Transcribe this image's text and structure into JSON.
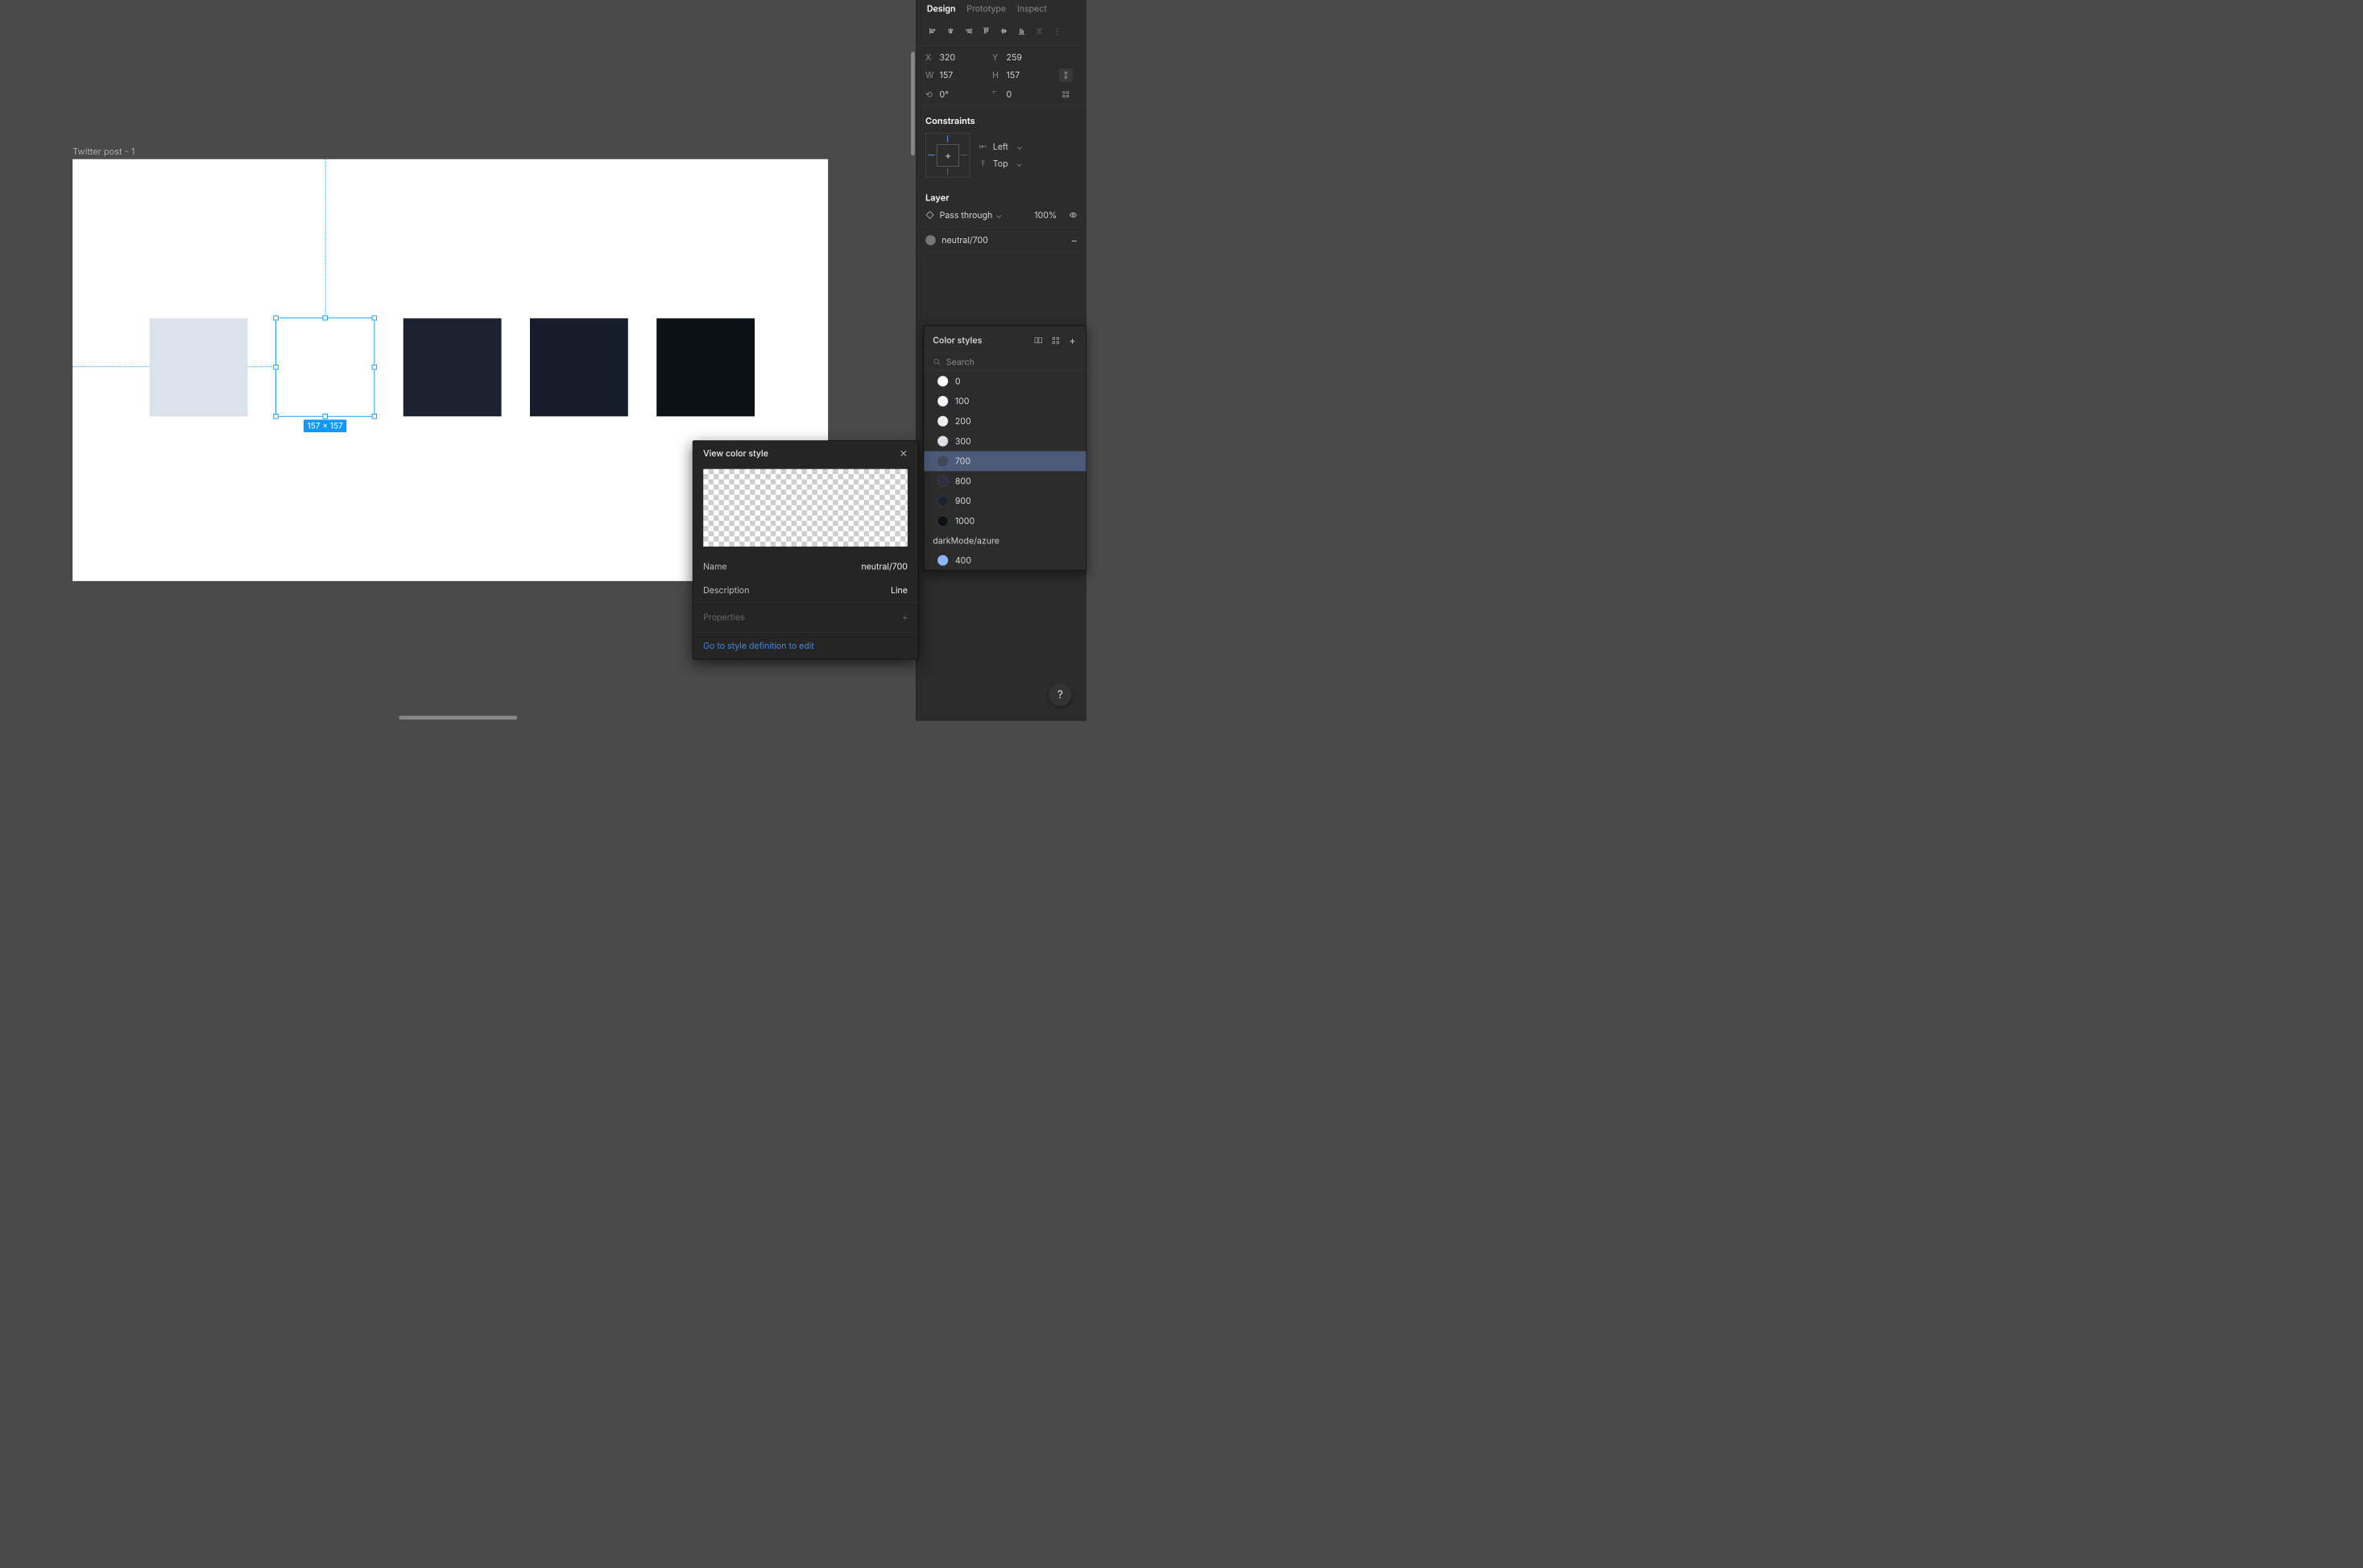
{
  "canvas": {
    "frameLabel": "Twitter post - 1",
    "selectionDims": "157 × 157"
  },
  "tabs": {
    "design": "Design",
    "prototype": "Prototype",
    "inspect": "Inspect"
  },
  "props": {
    "xLabel": "X",
    "x": "320",
    "yLabel": "Y",
    "y": "259",
    "wLabel": "W",
    "w": "157",
    "hLabel": "H",
    "h": "157",
    "rotLabel": "⤹",
    "rot": "0°",
    "radLabel": "⌐",
    "rad": "0"
  },
  "constraints": {
    "title": "Constraints",
    "horiz": "Left",
    "vert": "Top"
  },
  "layer": {
    "title": "Layer",
    "blend": "Pass through",
    "opacity": "100%"
  },
  "fill": {
    "name": "neutral/700"
  },
  "stylesPanel": {
    "title": "Color styles",
    "searchPlaceholder": "Search",
    "items": [
      {
        "label": "0",
        "color": "#ffffff"
      },
      {
        "label": "100",
        "color": "#f4f6fa"
      },
      {
        "label": "200",
        "color": "#ebeef3"
      },
      {
        "label": "300",
        "color": "#dbe0e8"
      },
      {
        "label": "700",
        "color": "#40485a",
        "selected": true
      },
      {
        "label": "800",
        "color": "#2a3040"
      },
      {
        "label": "900",
        "color": "#1c2230"
      },
      {
        "label": "1000",
        "color": "#0d1118"
      }
    ],
    "group2": "darkMode/azure",
    "group2items": [
      {
        "label": "400",
        "color": "#8db4ff"
      }
    ]
  },
  "popover": {
    "title": "View color style",
    "nameLabel": "Name",
    "nameValue": "neutral/700",
    "descLabel": "Description",
    "descValue": "Line",
    "propsLabel": "Properties",
    "link": "Go to style definition to edit"
  },
  "help": "?"
}
